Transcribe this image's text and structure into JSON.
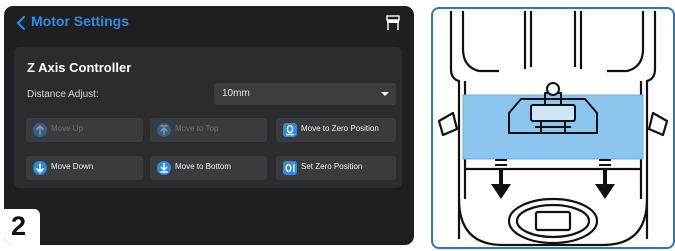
{
  "header": {
    "title": "Motor Settings",
    "back_icon": "chevron-left-icon",
    "right_icon": "printer-icon"
  },
  "controller": {
    "title": "Z Axis Controller",
    "distance_label": "Distance Adjust:",
    "distance_value": "10mm",
    "buttons": [
      {
        "label": "Move Up",
        "icon": "arrow-up-icon",
        "enabled": false
      },
      {
        "label": "Move to Top",
        "icon": "arrow-up-to-top-icon",
        "enabled": false
      },
      {
        "label": "Move to Zero Position",
        "icon": "zero-position-icon",
        "enabled": true
      },
      {
        "label": "Move Down",
        "icon": "arrow-down-icon",
        "enabled": true
      },
      {
        "label": "Move to Bottom",
        "icon": "arrow-down-to-bottom-icon",
        "enabled": true
      },
      {
        "label": "Set Zero Position",
        "icon": "set-zero-icon",
        "enabled": true
      }
    ]
  },
  "step": {
    "number": "2"
  },
  "colors": {
    "accent": "#2b8be6",
    "panel_bg": "#1e1f21",
    "card_bg": "#2b2c2f",
    "button_bg": "#3a3b3f",
    "highlight": "#8cc6ef",
    "illustration_border": "#2b78bf"
  }
}
